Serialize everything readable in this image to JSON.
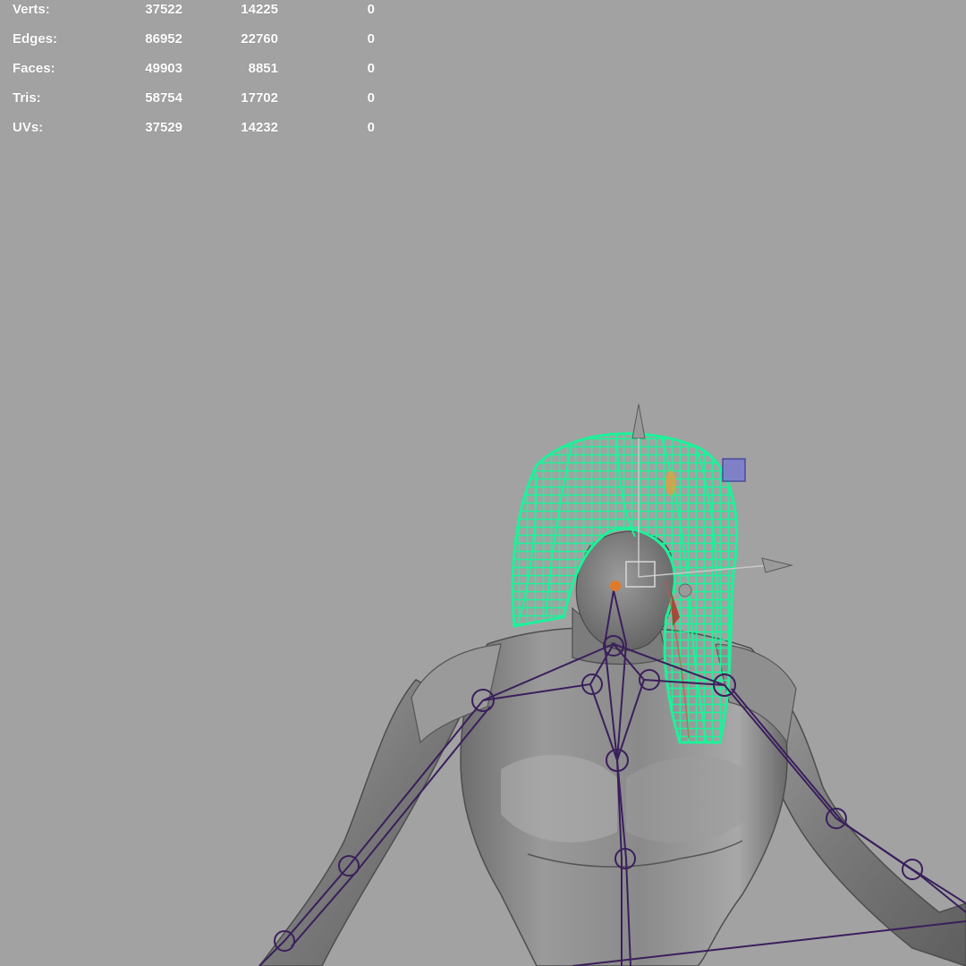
{
  "viewport": {
    "background_color": "#a2a2a2",
    "hair_wire_color": "#1cf29a",
    "skeleton_color": "#3a1f5c",
    "body_color": "#8c8c8c"
  },
  "hud": {
    "rows": [
      {
        "label": "Verts:",
        "c1": "37522",
        "c2": "14225",
        "c3": "0"
      },
      {
        "label": "Edges:",
        "c1": "86952",
        "c2": "22760",
        "c3": "0"
      },
      {
        "label": "Faces:",
        "c1": "49903",
        "c2": "8851",
        "c3": "0"
      },
      {
        "label": "Tris:",
        "c1": "58754",
        "c2": "17702",
        "c3": "0"
      },
      {
        "label": "UVs:",
        "c1": "37529",
        "c2": "14232",
        "c3": "0"
      }
    ]
  },
  "icons": {
    "manipulator": "move-manipulator-icon",
    "plane_handle": "plane-handle-icon"
  }
}
